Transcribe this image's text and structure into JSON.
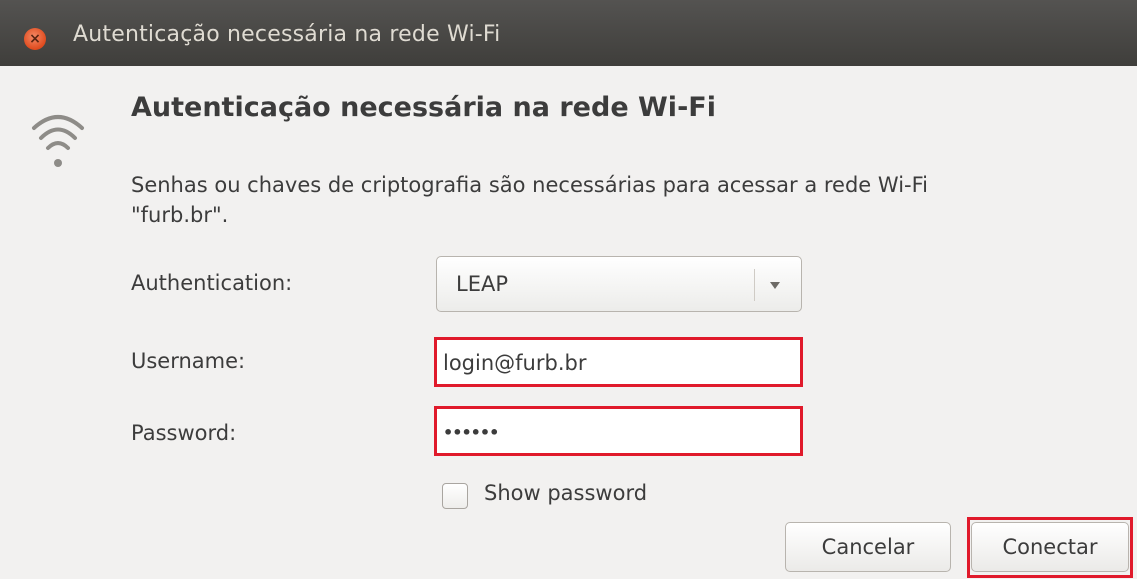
{
  "window": {
    "title": "Autenticação necessária na rede Wi-Fi",
    "close_glyph": "×"
  },
  "dialog": {
    "icon": "wifi-icon",
    "heading": "Autenticação necessária na rede Wi-Fi",
    "description_line1": "Senhas ou chaves de criptografia são necessárias para acessar a rede Wi-Fi",
    "description_line2": "\"furb.br\"."
  },
  "form": {
    "authentication_label": "Authentication:",
    "authentication_value": "LEAP",
    "username_label": "Username:",
    "username_value": "login@furb.br",
    "password_label": "Password:",
    "password_value": "••••••",
    "show_password_label": "Show password",
    "show_password_checked": false
  },
  "buttons": {
    "cancel": "Cancelar",
    "connect": "Conectar"
  },
  "colors": {
    "highlight": "#e01a2b",
    "titlebar": "#45443f",
    "close_button": "#e9582c"
  }
}
